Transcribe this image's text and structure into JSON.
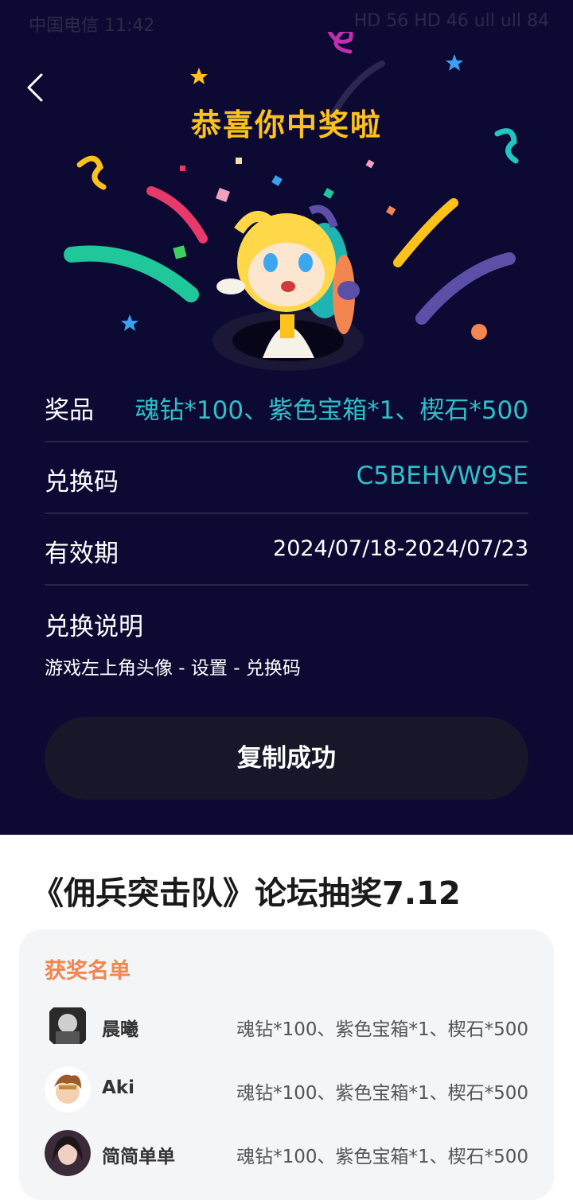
{
  "status_bar": {
    "carrier_time": "中国电信 11:42",
    "right": "HD 56 HD 46 ull ull 84"
  },
  "header": {
    "back_icon": "chevron-left-icon",
    "title": "恭喜你中奖啦"
  },
  "prize": {
    "label": "奖品",
    "value": "魂钻*100、紫色宝箱*1、楔石*500"
  },
  "code": {
    "label": "兑换码",
    "value": "C5BEHVW9SE"
  },
  "validity": {
    "label": "有效期",
    "value": "2024/07/18-2024/07/23"
  },
  "instructions": {
    "label": "兑换说明",
    "text": "游戏左上角头像 - 设置 - 兑换码"
  },
  "copy_button": "复制成功",
  "event": {
    "title": "《佣兵突击队》论坛抽奖7.12"
  },
  "winners": {
    "title": "获奖名单",
    "list": [
      {
        "name": "晨曦",
        "prize": "魂钻*100、紫色宝箱*1、楔石*500"
      },
      {
        "name": "Aki",
        "prize": "魂钻*100、紫色宝箱*1、楔石*500"
      },
      {
        "name": "简简单单",
        "prize": "魂钻*100、紫色宝箱*1、楔石*500"
      }
    ]
  },
  "colors": {
    "background": "#0c0a33",
    "title": "#ffc21a",
    "accent_teal": "#2fc0c8",
    "winners_title": "#f28550"
  }
}
